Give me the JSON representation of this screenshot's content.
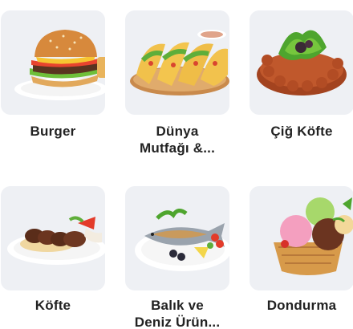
{
  "categories": [
    {
      "id": "burger",
      "label": "Burger",
      "icon": "burger-image"
    },
    {
      "id": "dunya",
      "label": "Dünya\nMutfağı &...",
      "icon": "tacos-image"
    },
    {
      "id": "cigkofte",
      "label": "Çiğ Köfte",
      "icon": "cig-kofte-image"
    },
    {
      "id": "kofte",
      "label": "Köfte",
      "icon": "kofte-plate-image"
    },
    {
      "id": "balik",
      "label": "Balık ve\nDeniz Ürün...",
      "icon": "fish-plate-image"
    },
    {
      "id": "dondurma",
      "label": "Dondurma",
      "icon": "ice-cream-image"
    }
  ]
}
